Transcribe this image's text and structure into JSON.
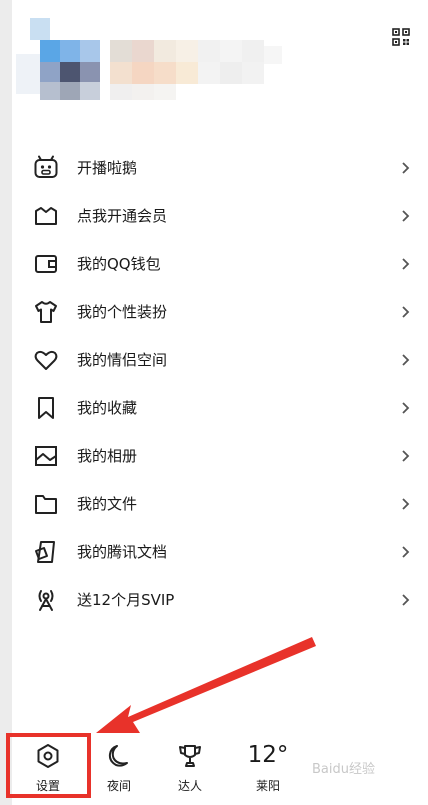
{
  "menu": {
    "items": [
      {
        "label": "开播啦鹅",
        "icon": "tv-mascot-icon"
      },
      {
        "label": "点我开通会员",
        "icon": "crown-icon"
      },
      {
        "label": "我的QQ钱包",
        "icon": "wallet-icon"
      },
      {
        "label": "我的个性装扮",
        "icon": "tshirt-icon"
      },
      {
        "label": "我的情侣空间",
        "icon": "heart-icon"
      },
      {
        "label": "我的收藏",
        "icon": "bookmark-icon"
      },
      {
        "label": "我的相册",
        "icon": "photo-icon"
      },
      {
        "label": "我的文件",
        "icon": "folder-icon"
      },
      {
        "label": "我的腾讯文档",
        "icon": "document-icon"
      },
      {
        "label": "送12个月SVIP",
        "icon": "broadcast-icon"
      }
    ]
  },
  "bottom_bar": {
    "settings_label": "设置",
    "night_label": "夜间",
    "expert_label": "达人",
    "weather_temp": "12°",
    "weather_city": "莱阳"
  },
  "watermark": "Baidu经验",
  "colors": {
    "highlight": "#e8322a",
    "text": "#1a1a1a",
    "chevron": "#555555"
  }
}
